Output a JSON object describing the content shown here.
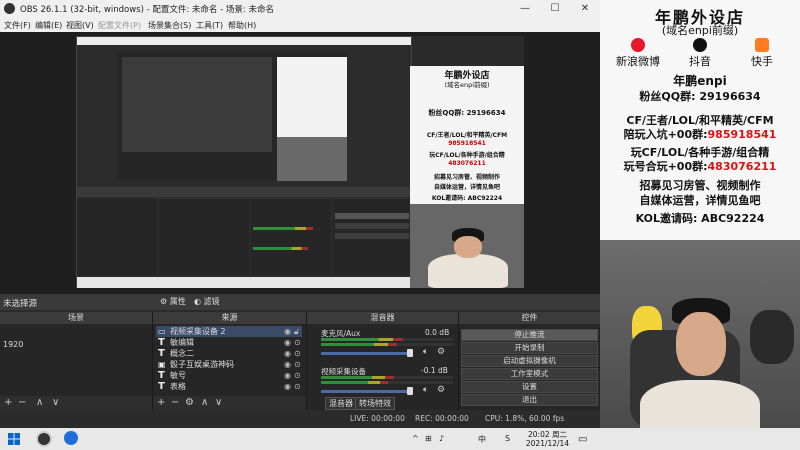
{
  "window": {
    "title": "OBS 26.1.1 (32-bit, windows) - 配置文件: 未命名 - 场景: 未命名",
    "controls": [
      "—",
      "☐",
      "✕"
    ]
  },
  "menu": [
    "文件(F)",
    "编辑(E)",
    "视图(V)",
    "配置文件(P)",
    "场景集合(S)",
    "工具(T)",
    "帮助(H)"
  ],
  "midbar": {
    "no_source": "未选择源",
    "properties": "属性",
    "filters": "滤镜"
  },
  "scenes": {
    "header": "场景",
    "items": [
      "1920"
    ]
  },
  "sources": {
    "header": "来源",
    "items": [
      {
        "icon": "video-capture",
        "label": "视频采集设备 2"
      },
      {
        "icon": "text",
        "label": "敏编辑"
      },
      {
        "icon": "text",
        "label": "概念二"
      },
      {
        "icon": "image",
        "label": "骰子互娱桌游神码"
      },
      {
        "icon": "text",
        "label": "敏号"
      },
      {
        "icon": "text",
        "label": "表格"
      }
    ]
  },
  "mixer": {
    "header": "混音器",
    "channels": [
      {
        "name": "麦克风/Aux",
        "db": "0.0 dB",
        "level": 0.62
      },
      {
        "name": "视频采集设备",
        "db": "-0.1 dB",
        "level": 0.55
      }
    ],
    "tabs": [
      "混音器",
      "转场特效"
    ]
  },
  "controls": {
    "header": "控件",
    "buttons": [
      "停止推流",
      "开始录制",
      "启动虚拟摄像机",
      "工作室模式",
      "设置",
      "退出"
    ]
  },
  "status": {
    "live": "LIVE: 00:00:00",
    "rec": "REC: 00:00:00",
    "cpu": "CPU: 1.8%, 60.00 fps"
  },
  "taskbar": {
    "clock_time": "20:02 周二",
    "clock_date": "2021/12/14",
    "tray_items": [
      "^",
      "⊞",
      "♪",
      "中",
      "S"
    ]
  },
  "ad": {
    "title": "年鹏外设店",
    "subtitle": "(域名enpi前缀)",
    "socials": [
      "新浪微博",
      "抖音",
      "快手"
    ],
    "handle": "年鹏enpi",
    "fans": "粉丝QQ群: 29196634",
    "line1": "CF/王者/LOL/和平精英/CFM",
    "line2_prefix": "陪玩入坑+00群:",
    "line2_num": "985918541",
    "line3": "玩CF/LOL/各种手游/组合精",
    "line4_prefix": "玩号合玩+00群:",
    "line4_num": "483076211",
    "line5": "招募见习房管、视频制作",
    "line6": "自媒体运营，详情见鱼吧",
    "line7": "KOL邀请码: ABC92224"
  },
  "colors": {
    "weibo": "#e6162d",
    "douyin": "#111111",
    "kuaishou": "#ff7b1f",
    "selected_row": "#3a4b68"
  }
}
